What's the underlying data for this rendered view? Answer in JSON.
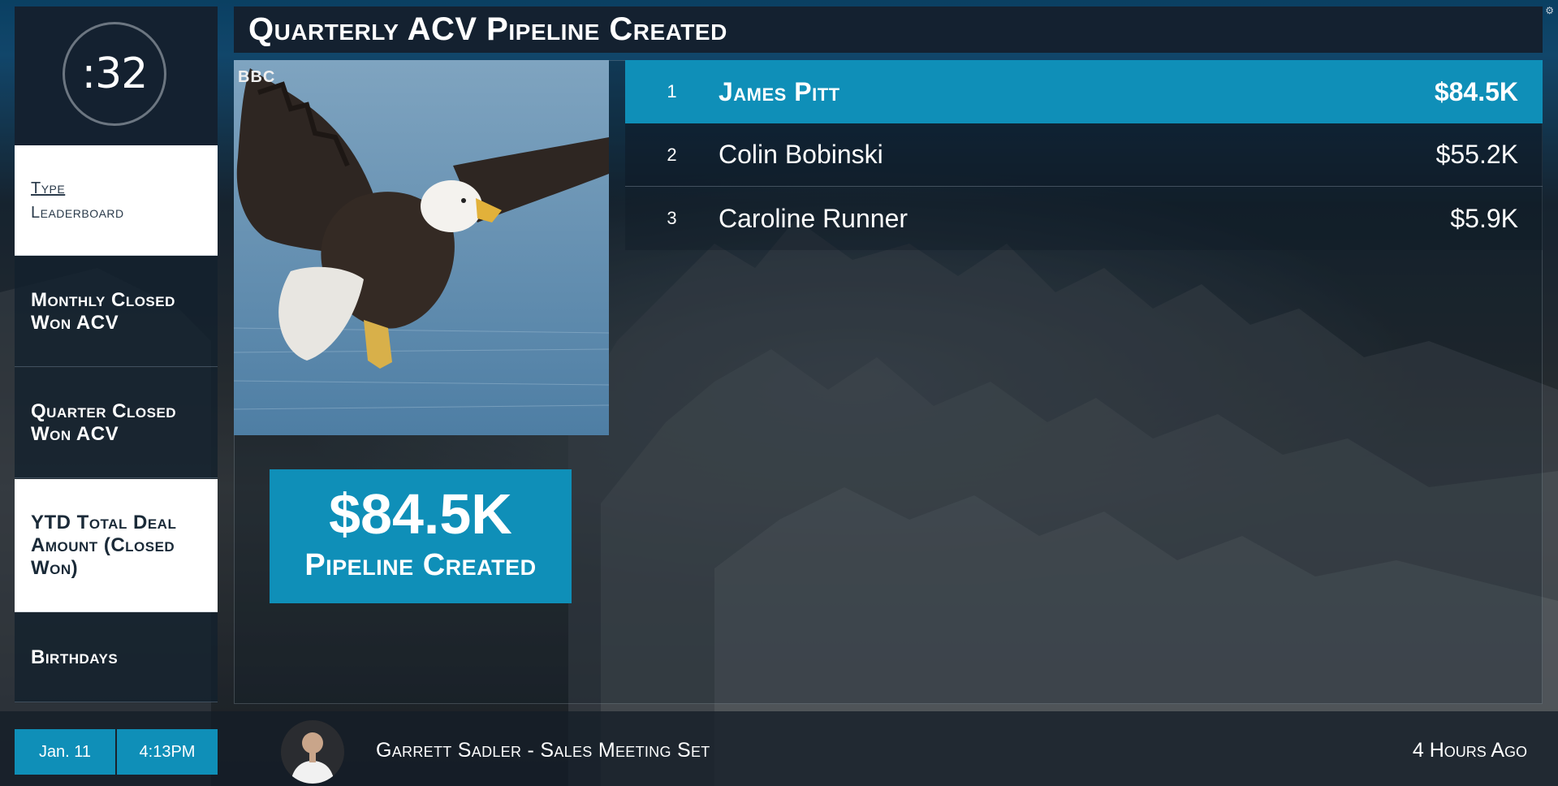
{
  "timer": {
    "value": ":32"
  },
  "sidebar": {
    "items": [
      {
        "label_line1": "Type",
        "label_line2": "Leaderboard",
        "selected": false,
        "style": "light"
      },
      {
        "label": "Monthly Closed Won ACV",
        "style": "dark"
      },
      {
        "label": "Quarter Closed Won ACV",
        "style": "dark"
      },
      {
        "label": "YTD Total Deal Amount (Closed Won)",
        "style": "light"
      },
      {
        "label": "Birthdays",
        "style": "dark"
      }
    ]
  },
  "header": {
    "title": "Quarterly ACV Pipeline Created"
  },
  "media": {
    "watermark": "BBC",
    "subject_icon": "eagle-image"
  },
  "highlight": {
    "value": "$84.5K",
    "label": "Pipeline Created"
  },
  "leaderboard": {
    "rows": [
      {
        "rank": "1",
        "name": "James Pitt",
        "amount": "$84.5K"
      },
      {
        "rank": "2",
        "name": "Colin Bobinski",
        "amount": "$55.2K"
      },
      {
        "rank": "3",
        "name": "Caroline Runner",
        "amount": "$5.9K"
      }
    ]
  },
  "footer": {
    "date": "Jan. 11",
    "time": "4:13PM",
    "activity": "Garrett Sadler - Sales Meeting Set",
    "ago": "4 Hours Ago"
  },
  "colors": {
    "accent": "#0f8fb8",
    "panel_dark": "#142130",
    "text": "#ffffff"
  }
}
